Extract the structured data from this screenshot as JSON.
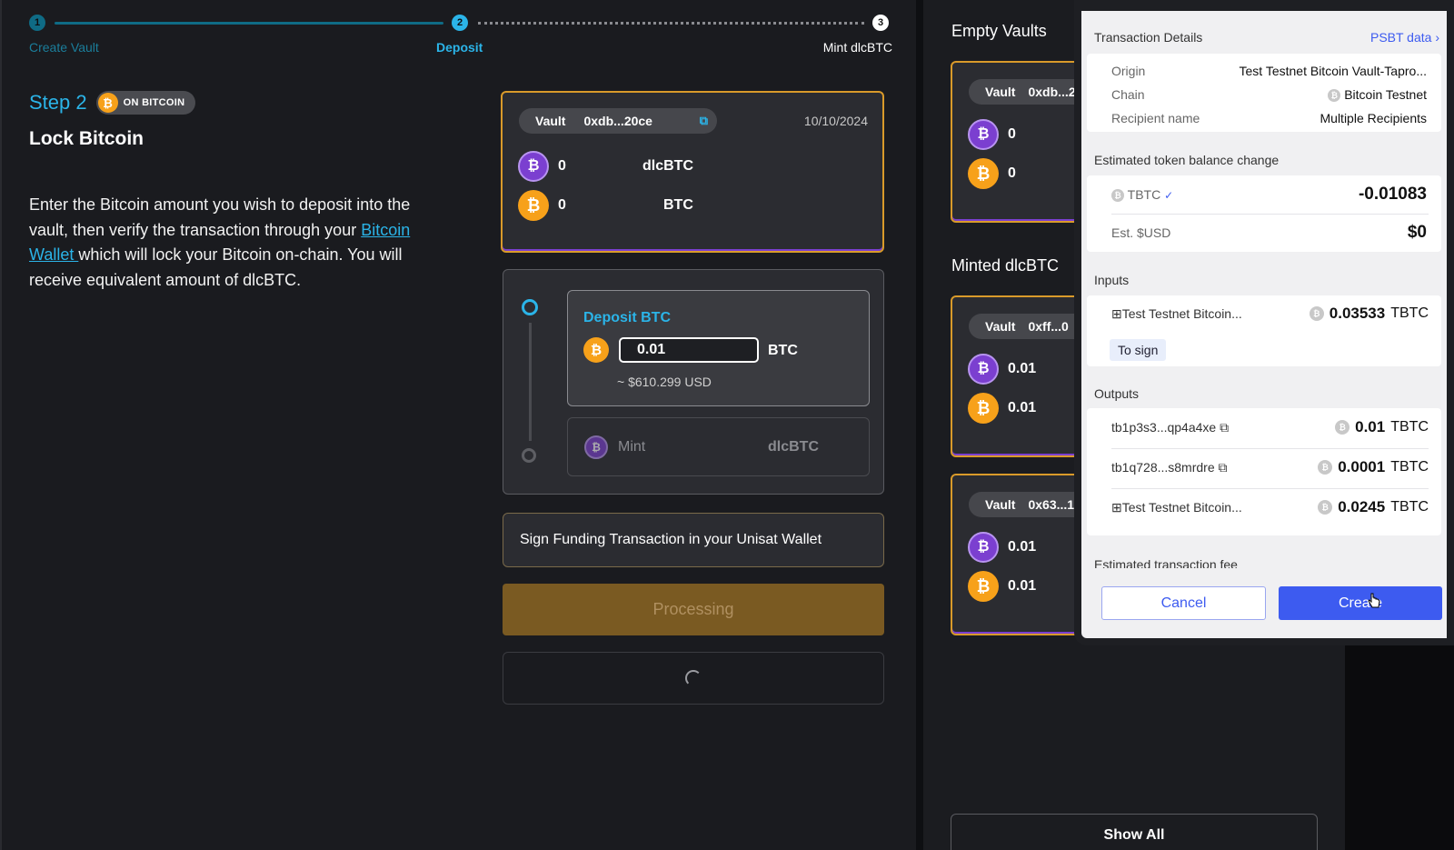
{
  "stepper": {
    "step1_num": "1",
    "step1_label": "Create Vault",
    "step2_num": "2",
    "step2_label": "Deposit",
    "step3_num": "3",
    "step3_label": "Mint dlcBTC"
  },
  "step": {
    "title": "Step 2",
    "badge": "ON BITCOIN",
    "heading": "Lock Bitcoin",
    "desc_before": "Enter the Bitcoin amount you wish to deposit into the vault, then verify the transaction through your ",
    "desc_link": "Bitcoin Wallet ",
    "desc_after": "which will lock your Bitcoin on-chain. You will receive equivalent amount of dlcBTC."
  },
  "vault_card": {
    "label": "Vault",
    "address": "0xdb...20ce",
    "date": "10/10/2024",
    "rows": [
      {
        "amount": "0",
        "unit": "dlcBTC"
      },
      {
        "amount": "0",
        "unit": "BTC"
      }
    ]
  },
  "deposit": {
    "title": "Deposit BTC",
    "input_value": "0.01",
    "unit": "BTC",
    "usd": "~ $610.299 USD",
    "mint_label": "Mint",
    "mint_unit": "dlcBTC"
  },
  "sign_text": "Sign Funding Transaction in your Unisat Wallet",
  "processing_label": "Processing",
  "sidebar": {
    "empty_title": "Empty Vaults",
    "minted_title": "Minted dlcBTC",
    "show_all": "Show All",
    "empty_vault": {
      "label": "Vault",
      "address": "0xdb...2",
      "dlc": "0",
      "btc": "0"
    },
    "minted_vaults": [
      {
        "label": "Vault",
        "address": "0xff...0",
        "dlc": "0.01",
        "btc": "0.01"
      },
      {
        "label": "Vault",
        "address": "0x63...1",
        "dlc": "0.01",
        "btc": "0.01"
      }
    ]
  },
  "popup": {
    "header": "Transaction Details",
    "psbt_link": "PSBT data",
    "origin_key": "Origin",
    "origin_val": "Test Testnet Bitcoin Vault-Tapro...",
    "chain_key": "Chain",
    "chain_val": "Bitcoin Testnet",
    "recipient_key": "Recipient name",
    "recipient_val": "Multiple Recipients",
    "balance_title": "Estimated token balance change",
    "token": "TBTC",
    "token_change": "-0.01083",
    "usd_key": "Est. $USD",
    "usd_val": "$0",
    "inputs_title": "Inputs",
    "input_name": "Test Testnet Bitcoin...",
    "input_amount": "0.03533",
    "input_unit": "TBTC",
    "to_sign": "To sign",
    "outputs_title": "Outputs",
    "outputs": [
      {
        "addr": "tb1p3s3...qp4a4xe",
        "amount": "0.01",
        "unit": "TBTC"
      },
      {
        "addr": "tb1q728...s8mrdre",
        "amount": "0.0001",
        "unit": "TBTC"
      },
      {
        "addr": "Test Testnet Bitcoin...",
        "amount": "0.0245",
        "unit": "TBTC"
      }
    ],
    "fee_title": "Estimated transaction fee",
    "cancel": "Cancel",
    "create": "Create"
  }
}
